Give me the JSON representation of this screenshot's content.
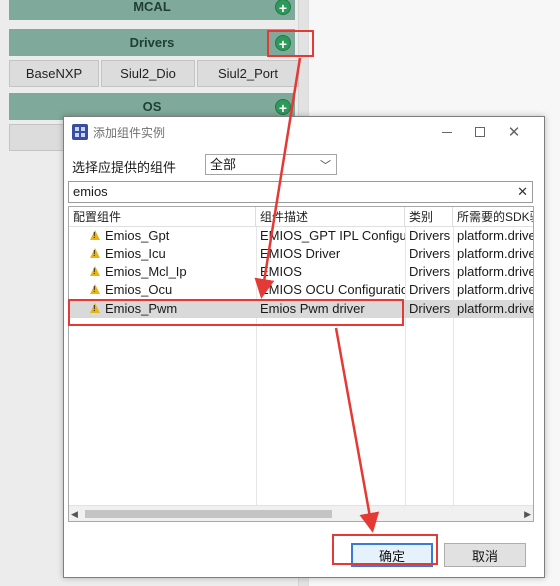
{
  "background": {
    "categories": [
      {
        "label": "MCAL"
      },
      {
        "label": "Drivers"
      },
      {
        "label": "OS"
      }
    ],
    "driver_components": [
      "BaseNXP",
      "Siul2_Dio",
      "Siul2_Port"
    ],
    "colors": {
      "header": "#7fa99a",
      "add_button": "#2e9a5a"
    }
  },
  "dialog": {
    "title": "添加组件实例",
    "filter_label": "选择应提供的组件",
    "filter_value": "全部",
    "search_value": "emios",
    "columns": [
      "配置组件",
      "组件描述",
      "类别",
      "所需要的SDK驱动"
    ],
    "rows": [
      {
        "name": "Emios_Gpt",
        "description": "EMIOS_GPT IPL Configuration",
        "category": "Drivers",
        "sdk": "platform.driver"
      },
      {
        "name": "Emios_Icu",
        "description": "EMIOS Driver",
        "category": "Drivers",
        "sdk": "platform.driver"
      },
      {
        "name": "Emios_Mcl_Ip",
        "description": "EMIOS",
        "category": "Drivers",
        "sdk": "platform.driver"
      },
      {
        "name": "Emios_Ocu",
        "description": "EMIOS OCU Configuration",
        "category": "Drivers",
        "sdk": "platform.driver"
      },
      {
        "name": "Emios_Pwm",
        "description": "Emios Pwm driver",
        "category": "Drivers",
        "sdk": "platform.driver"
      }
    ],
    "selected_row": "Emios_Pwm",
    "ok_label": "确定",
    "cancel_label": "取消"
  },
  "annotation_color": "#e53935"
}
